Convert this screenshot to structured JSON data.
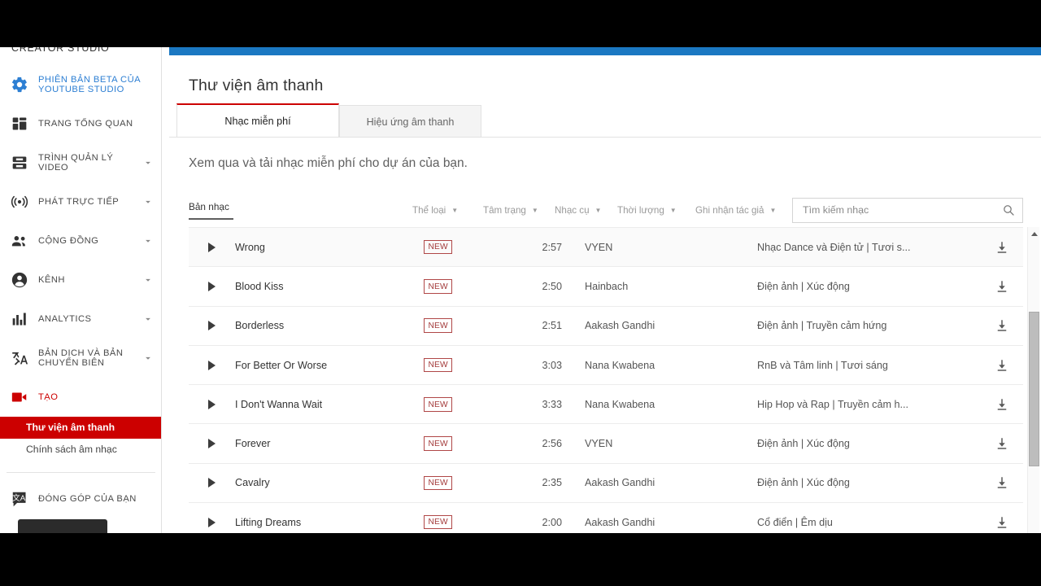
{
  "sidebar": {
    "header": "CREATOR STUDIO",
    "items": [
      {
        "label": "PHIÊN BẢN BETA CỦA YOUTUBE STUDIO",
        "icon": "gear-icon",
        "chevron": false,
        "style": "beta"
      },
      {
        "label": "TRANG TỔNG QUAN",
        "icon": "dashboard-icon",
        "chevron": false,
        "style": "normal"
      },
      {
        "label": "TRÌNH QUẢN LÝ VIDEO",
        "icon": "video-manager-icon",
        "chevron": true,
        "style": "normal"
      },
      {
        "label": "PHÁT TRỰC TIẾP",
        "icon": "live-broadcast-icon",
        "chevron": true,
        "style": "normal"
      },
      {
        "label": "CỘNG ĐỒNG",
        "icon": "people-icon",
        "chevron": true,
        "style": "normal"
      },
      {
        "label": "KÊNH",
        "icon": "account-circle-icon",
        "chevron": true,
        "style": "normal"
      },
      {
        "label": "ANALYTICS",
        "icon": "bar-chart-icon",
        "chevron": true,
        "style": "normal"
      },
      {
        "label": "BẢN DỊCH VÀ BẢN CHUYỂN BIÊN",
        "icon": "translate-icon",
        "chevron": true,
        "style": "normal"
      },
      {
        "label": "TẠO",
        "icon": "video-camera-icon",
        "chevron": false,
        "style": "create"
      }
    ],
    "sub_items": [
      {
        "label": "Thư viện âm thanh",
        "active": true
      },
      {
        "label": "Chính sách âm nhạc",
        "active": false
      }
    ],
    "footer_items": [
      {
        "label": "ĐÓNG GÓP CỦA BẠN",
        "icon": "translate-contribute-icon",
        "chevron": false,
        "style": "normal"
      }
    ],
    "accent_color": "#cc0000",
    "beta_color": "#2d7fd3"
  },
  "content": {
    "page_title": "Thư viện âm thanh",
    "top_bar_color": "#1b78c2",
    "tabs": [
      {
        "label": "Nhạc miễn phí",
        "active": true
      },
      {
        "label": "Hiệu ứng âm thanh",
        "active": false
      }
    ],
    "subtitle": "Xem qua và tải nhạc miễn phí cho dự án của bạn.",
    "filters": {
      "sort_label": "Bản nhạc",
      "genre": "Thể loại",
      "mood": "Tâm trạng",
      "instrument": "Nhạc cụ",
      "duration": "Thời lượng",
      "attribution": "Ghi nhận tác giả"
    },
    "search": {
      "placeholder": "Tìm kiếm nhạc",
      "value": "",
      "icon": "search-icon"
    },
    "badge_label": "NEW",
    "badge_color": "#a33a3a",
    "tracks": [
      {
        "title": "Wrong",
        "badge": "NEW",
        "duration": "2:57",
        "artist": "VYEN",
        "genre": "Nhạc Dance và Điện tử | Tươi s..."
      },
      {
        "title": "Blood Kiss",
        "badge": "NEW",
        "duration": "2:50",
        "artist": "Hainbach",
        "genre": "Điện ảnh | Xúc động"
      },
      {
        "title": "Borderless",
        "badge": "NEW",
        "duration": "2:51",
        "artist": "Aakash Gandhi",
        "genre": "Điện ảnh | Truyền cảm hứng"
      },
      {
        "title": "For Better Or Worse",
        "badge": "NEW",
        "duration": "3:03",
        "artist": "Nana Kwabena",
        "genre": "RnB và Tâm linh | Tươi sáng"
      },
      {
        "title": "I Don't Wanna Wait",
        "badge": "NEW",
        "duration": "3:33",
        "artist": "Nana Kwabena",
        "genre": "Hip Hop và Rap | Truyền cảm h..."
      },
      {
        "title": "Forever",
        "badge": "NEW",
        "duration": "2:56",
        "artist": "VYEN",
        "genre": "Điện ảnh | Xúc động"
      },
      {
        "title": "Cavalry",
        "badge": "NEW",
        "duration": "2:35",
        "artist": "Aakash Gandhi",
        "genre": "Điện ảnh | Xúc động"
      },
      {
        "title": "Lifting Dreams",
        "badge": "NEW",
        "duration": "2:00",
        "artist": "Aakash Gandhi",
        "genre": "Cổ điển | Êm dịu"
      }
    ]
  }
}
